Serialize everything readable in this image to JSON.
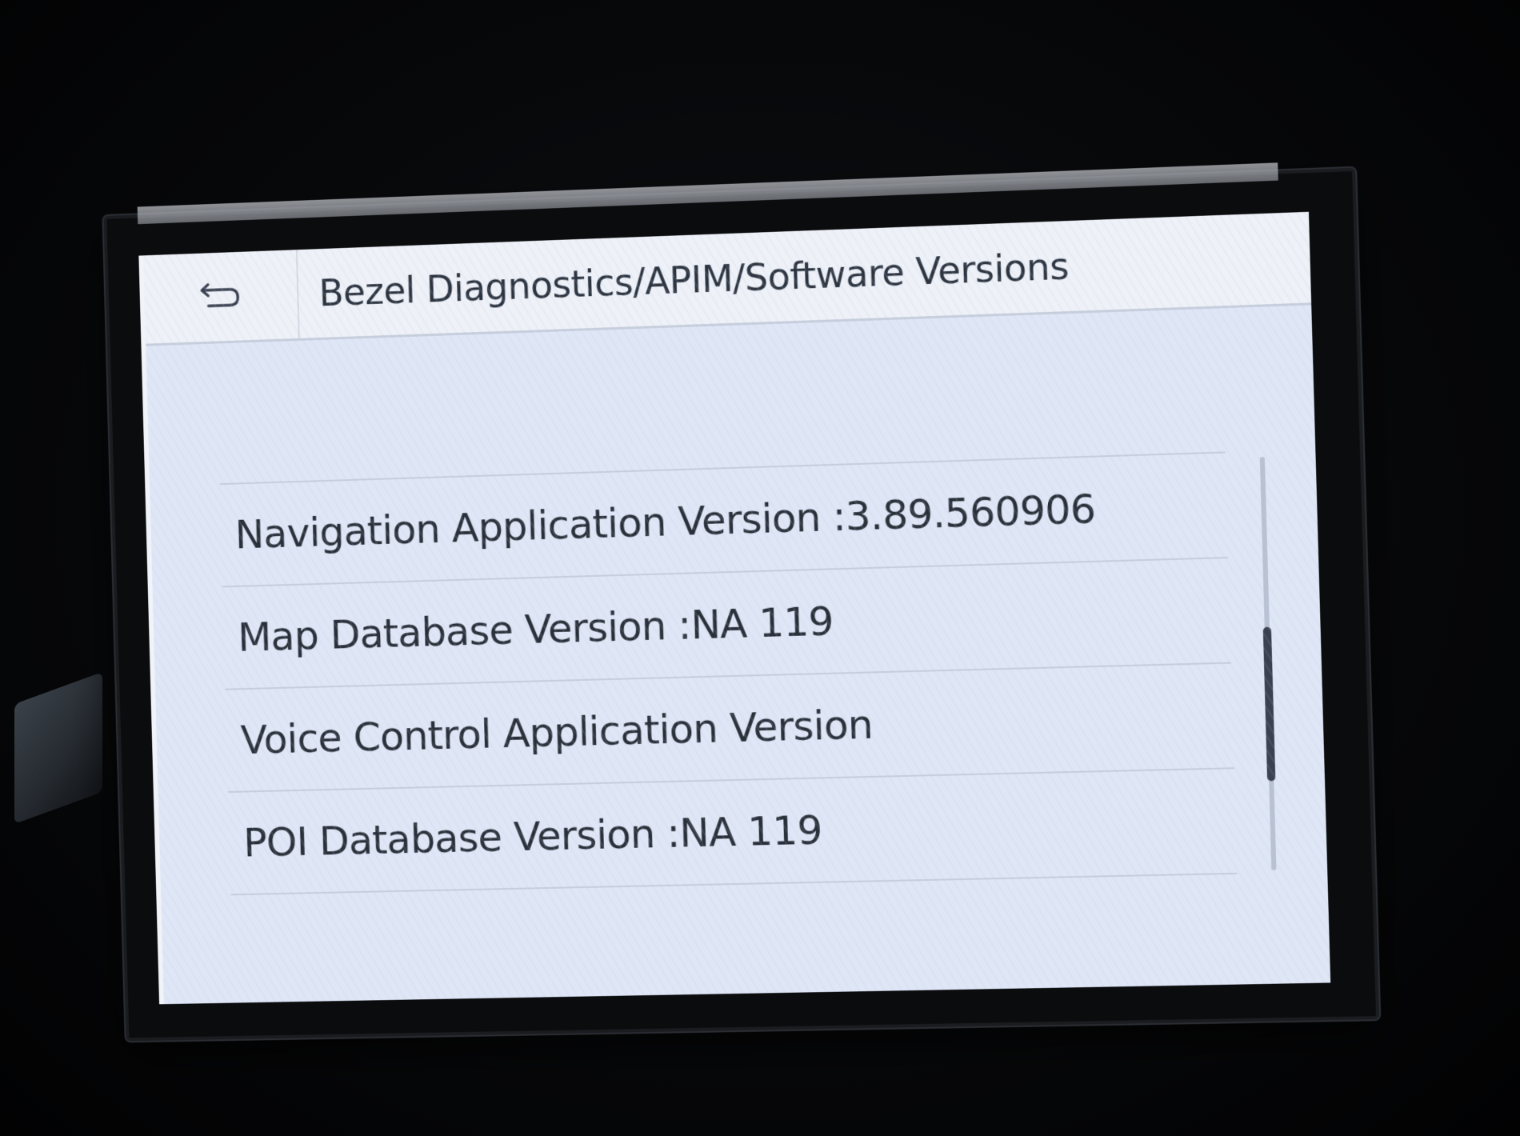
{
  "header": {
    "back_icon": "back-arrow-icon",
    "title": "Bezel Diagnostics/APIM/Software Versions"
  },
  "list": {
    "items": [
      {
        "label": "Navigation Application Version :3.89.560906"
      },
      {
        "label": "Map Database Version :NA 119"
      },
      {
        "label": "Voice Control Application Version"
      },
      {
        "label": "POI Database Version :NA 119"
      }
    ]
  },
  "colors": {
    "screen_bg": "#dfe6f6",
    "header_bg": "#eef1f7",
    "text": "#2a3039",
    "divider": "#c6cedd"
  }
}
